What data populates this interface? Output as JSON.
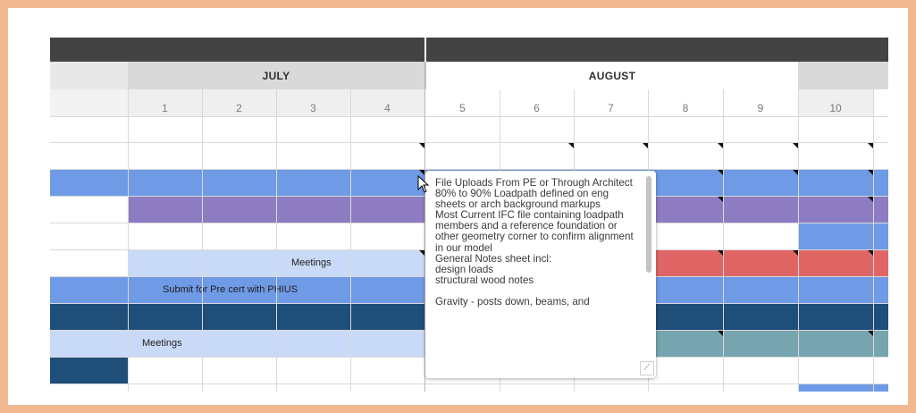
{
  "calendar": {
    "months": [
      {
        "label": "JULY"
      },
      {
        "label": "AUGUST"
      }
    ],
    "days": [
      "1",
      "2",
      "3",
      "4",
      "5",
      "6",
      "7",
      "8",
      "9",
      "10"
    ]
  },
  "cells": {
    "meetings_1": "Meetings",
    "submit_precert": "Submit for Pre cert with PHIUS",
    "meetings_2": "Meetings"
  },
  "comment": {
    "text": "File Uploads From PE or Through Architect\n80% to 90% Loadpath defined on eng sheets or arch background markups\nMost Current IFC file containing loadpath members and a reference foundation or other geometry corner to confirm alignment in our model\nGeneral Notes sheet incl:\ndesign loads\nstructural wood notes\n\nGravity - posts down, beams, and",
    "resize_glyph": "⟋"
  },
  "colors": {
    "blue": "#6f9ae6",
    "purple": "#8e7cc3",
    "light_blue": "#c9daf8",
    "navy": "#1f4e79",
    "red": "#e06666",
    "teal": "#76a5af",
    "header_gray": "#434343",
    "month_gray": "#d9d9d9"
  }
}
